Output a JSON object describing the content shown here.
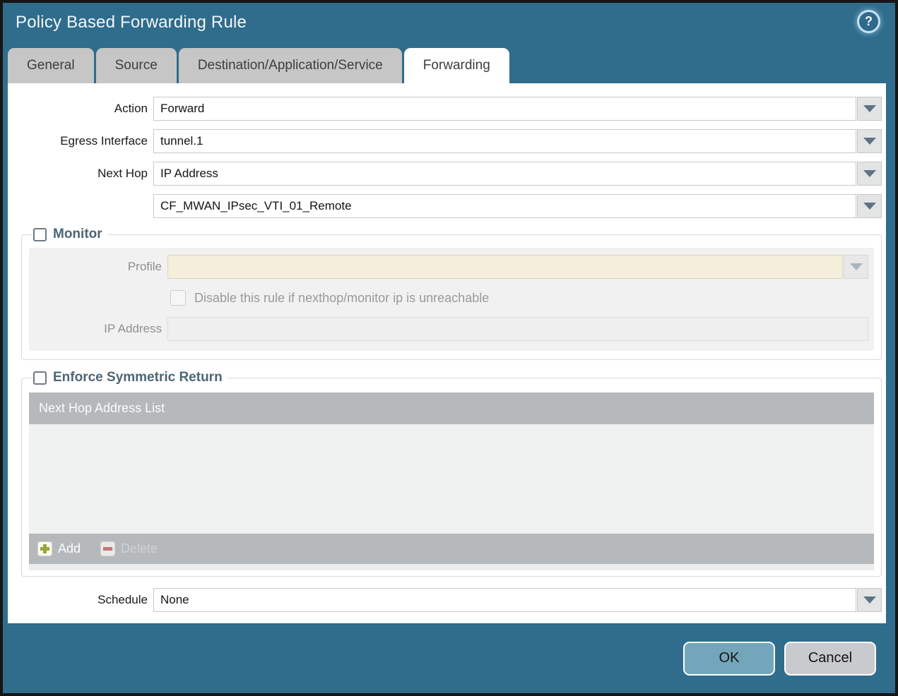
{
  "colors": {
    "frame_teal": "#306c8c",
    "tab_gray": "#c6c6c6",
    "legend_slate": "#4d6577",
    "table_gray": "#b5b9bb",
    "panel_gray": "#f1f1f1",
    "profile_cream": "#f5eedb",
    "ok_button": "#73a6ba",
    "cancel_button": "#c9cacd",
    "add_plus_green": "#9aa43c",
    "delete_minus_red": "#c4757c"
  },
  "dialog": {
    "title": "Policy Based Forwarding Rule",
    "help_glyph": "?"
  },
  "tabs": [
    {
      "label": "General"
    },
    {
      "label": "Source"
    },
    {
      "label": "Destination/Application/Service"
    },
    {
      "label": "Forwarding",
      "active": true
    }
  ],
  "form": {
    "action": {
      "label": "Action",
      "value": "Forward"
    },
    "egress_interface": {
      "label": "Egress Interface",
      "value": "tunnel.1"
    },
    "next_hop": {
      "label": "Next Hop",
      "value": "IP Address"
    },
    "next_hop_address": {
      "value": "CF_MWAN_IPsec_VTI_01_Remote"
    },
    "schedule": {
      "label": "Schedule",
      "value": "None"
    }
  },
  "monitor": {
    "legend": "Monitor",
    "checked": false,
    "profile": {
      "label": "Profile",
      "value": ""
    },
    "disable_rule_label": "Disable this rule if nexthop/monitor ip is unreachable",
    "disable_rule_checked": false,
    "ip_address": {
      "label": "IP Address",
      "value": ""
    }
  },
  "symmetric_return": {
    "legend": "Enforce Symmetric Return",
    "checked": false,
    "table_header": "Next Hop Address List",
    "rows": [],
    "add_label": "Add",
    "delete_label": "Delete"
  },
  "footer": {
    "ok_label": "OK",
    "cancel_label": "Cancel"
  }
}
